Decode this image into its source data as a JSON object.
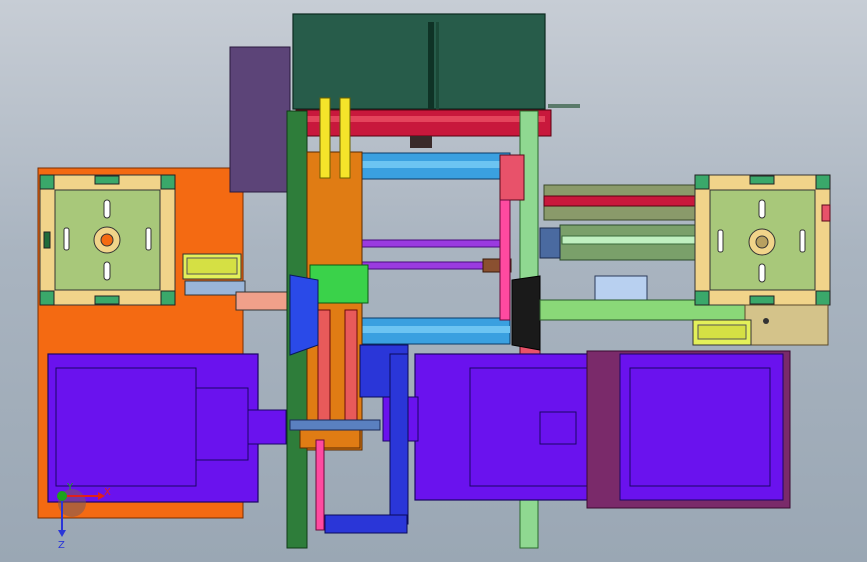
{
  "axes": {
    "x_label": "X",
    "y_label": "Y",
    "z_label": "Z"
  },
  "colors": {
    "background_top": "#c7cdd5",
    "background_bottom": "#9aa7b4",
    "motor_purple": "#6a12ee",
    "plate_orange": "#f46a12",
    "frame_green": "#2e7d3a",
    "frame_light_green": "#8fd891",
    "top_box_green": "#275c4a",
    "block_orange": "#e07c14",
    "rail_red": "#c8183c",
    "rail_blue": "#3aa0e0",
    "fixture_sage": "#a8c87a",
    "fixture_cream": "#f1d48a",
    "axis_red": "#e0201c",
    "axis_green": "#1ca31c",
    "axis_blue": "#2a36d8"
  }
}
